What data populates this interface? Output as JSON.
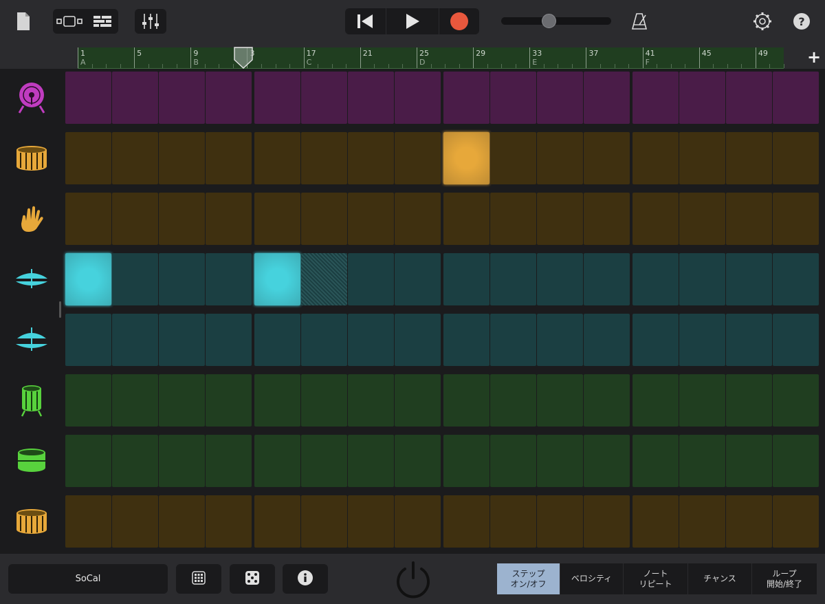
{
  "toolbar": {
    "icons": [
      "file-icon",
      "track-view-icon",
      "step-sequencer-view-icon",
      "mixer-icon",
      "go-to-start-icon",
      "play-icon",
      "record-icon",
      "metronome-icon",
      "settings-icon",
      "help-icon"
    ],
    "master_volume": 0.43,
    "record_color": "#e8583d"
  },
  "ruler": {
    "labels": [
      {
        "num": "1",
        "sub": "A"
      },
      {
        "num": "5",
        "sub": ""
      },
      {
        "num": "9",
        "sub": "B"
      },
      {
        "num": "3",
        "sub": ""
      },
      {
        "num": "17",
        "sub": "C"
      },
      {
        "num": "21",
        "sub": ""
      },
      {
        "num": "25",
        "sub": "D"
      },
      {
        "num": "29",
        "sub": ""
      },
      {
        "num": "33",
        "sub": "E"
      },
      {
        "num": "37",
        "sub": ""
      },
      {
        "num": "41",
        "sub": "F"
      },
      {
        "num": "45",
        "sub": ""
      },
      {
        "num": "49",
        "sub": ""
      }
    ],
    "add_label": "+",
    "track_color": "#203e20"
  },
  "rows": [
    {
      "instrument": "kick-drum-icon",
      "color": "#c03cc0",
      "cell": "#4a1c48",
      "on": []
    },
    {
      "instrument": "snare-drum-icon",
      "color": "#e7a83a",
      "cell": "#3f3010",
      "on": [
        8
      ]
    },
    {
      "instrument": "clap-hand-icon",
      "color": "#e7a83a",
      "cell": "#3f3010",
      "on": []
    },
    {
      "instrument": "closed-hihat-icon",
      "color": "#46d2dd",
      "cell": "#1b3f42",
      "on": [
        0,
        4
      ],
      "dim": [
        5
      ]
    },
    {
      "instrument": "open-hihat-icon",
      "color": "#46d2dd",
      "cell": "#1b3f42",
      "on": []
    },
    {
      "instrument": "tom-high-icon",
      "color": "#58d23d",
      "cell": "#203e20",
      "on": []
    },
    {
      "instrument": "tom-low-icon",
      "color": "#58d23d",
      "cell": "#203e20",
      "on": []
    },
    {
      "instrument": "snare-alt-icon",
      "color": "#e7a83a",
      "cell": "#3f3010",
      "on": []
    }
  ],
  "bottom": {
    "kit_name": "SoCal",
    "tabs": [
      {
        "line1": "ステップ",
        "line2": "オン/オフ",
        "active": true
      },
      {
        "line1": "ベロシティ",
        "line2": "",
        "active": false
      },
      {
        "line1": "ノート",
        "line2": "リピート",
        "active": false
      },
      {
        "line1": "チャンス",
        "line2": "",
        "active": false
      },
      {
        "line1": "ループ",
        "line2": "開始/終了",
        "active": false
      }
    ]
  }
}
